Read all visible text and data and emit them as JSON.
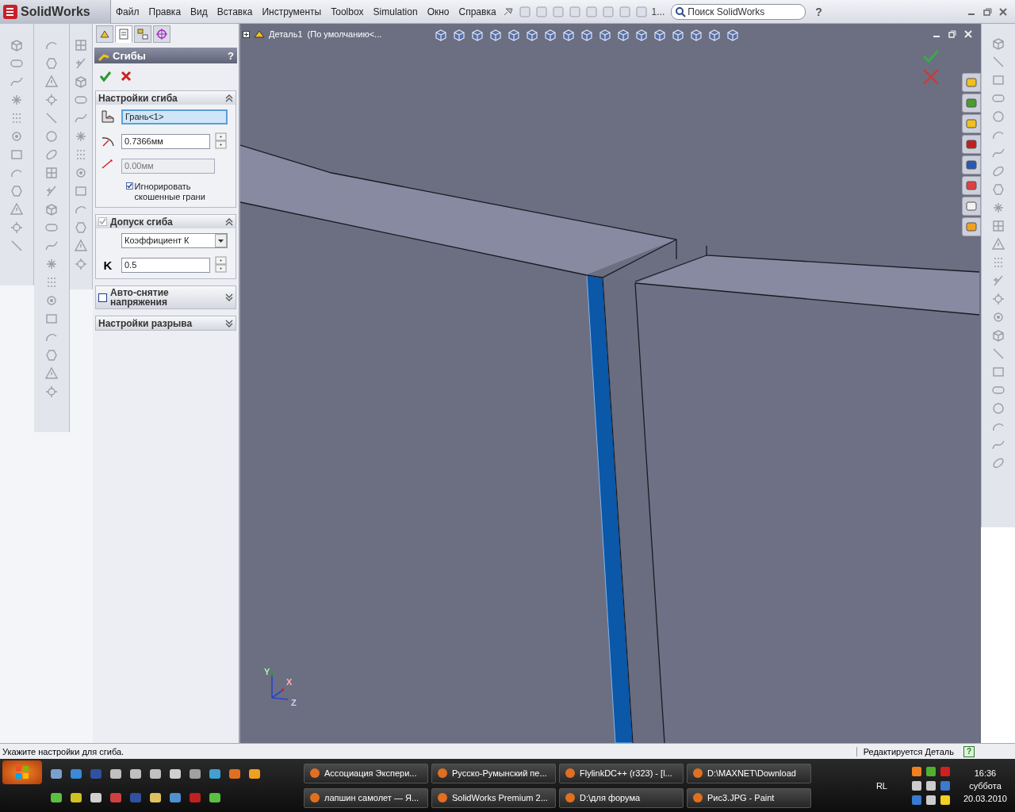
{
  "app": {
    "title": "SolidWorks"
  },
  "menu": [
    {
      "label": "Файл"
    },
    {
      "label": "Правка"
    },
    {
      "label": "Вид"
    },
    {
      "label": "Вставка"
    },
    {
      "label": "Инструменты"
    },
    {
      "label": "Toolbox"
    },
    {
      "label": "Simulation"
    },
    {
      "label": "Окно"
    },
    {
      "label": "Справка"
    }
  ],
  "toolbar": {
    "overflow": "1..."
  },
  "search": {
    "placeholder": "Поиск SolidWorks"
  },
  "help": "?",
  "pm_tabs": [
    {
      "selected": false
    },
    {
      "selected": true
    },
    {
      "selected": false
    },
    {
      "selected": false
    }
  ],
  "property_manager": {
    "title": "Сгибы",
    "help": "?",
    "sections": [
      {
        "title": "Настройки сгиба",
        "expanded": true,
        "rows": [
          {
            "kind": "selection",
            "value": "Грань<1>",
            "active": true
          },
          {
            "kind": "radius",
            "value": "0.7366мм"
          },
          {
            "kind": "offset",
            "value": "0.00мм",
            "disabled": true
          },
          {
            "kind": "checkbox",
            "label": "Игнорировать скошенные грани",
            "checked": true
          }
        ]
      },
      {
        "title": "Допуск сгиба",
        "expanded": true,
        "checked": true,
        "disabled": true,
        "rows": [
          {
            "kind": "dropdown",
            "value": "Коэффициент К"
          },
          {
            "kind": "factor",
            "label": "K",
            "value": "0.5"
          }
        ]
      },
      {
        "title": "Авто-снятие напряжения",
        "expanded": false,
        "checked": false,
        "disabled": false
      },
      {
        "title": "Настройки разрыва",
        "expanded": false
      }
    ]
  },
  "viewport": {
    "tree_item": "Деталь1  (По умолчанию<...",
    "triad": [
      "Y",
      "X",
      "Z"
    ]
  },
  "status_bar": {
    "message": "Укажите настройки для сгиба.",
    "mode": "Редактируется Деталь",
    "help": "?"
  },
  "taskbar": {
    "tasks": [
      {
        "label": "Ассоциация Экспери..."
      },
      {
        "label": "Русско-Румынский пе..."
      },
      {
        "label": "FlylinkDC++ (r323) - [l..."
      },
      {
        "label": "D:\\MAXNET\\Download"
      },
      {
        "label": "лапшин самолет — Я..."
      },
      {
        "label": "SolidWorks Premium 2..."
      },
      {
        "label": "D:\\для форума"
      },
      {
        "label": "Рис3.JPG - Paint"
      }
    ],
    "language": "RL",
    "time": "16:36",
    "day": "суббота",
    "date": "20.03.2010"
  }
}
